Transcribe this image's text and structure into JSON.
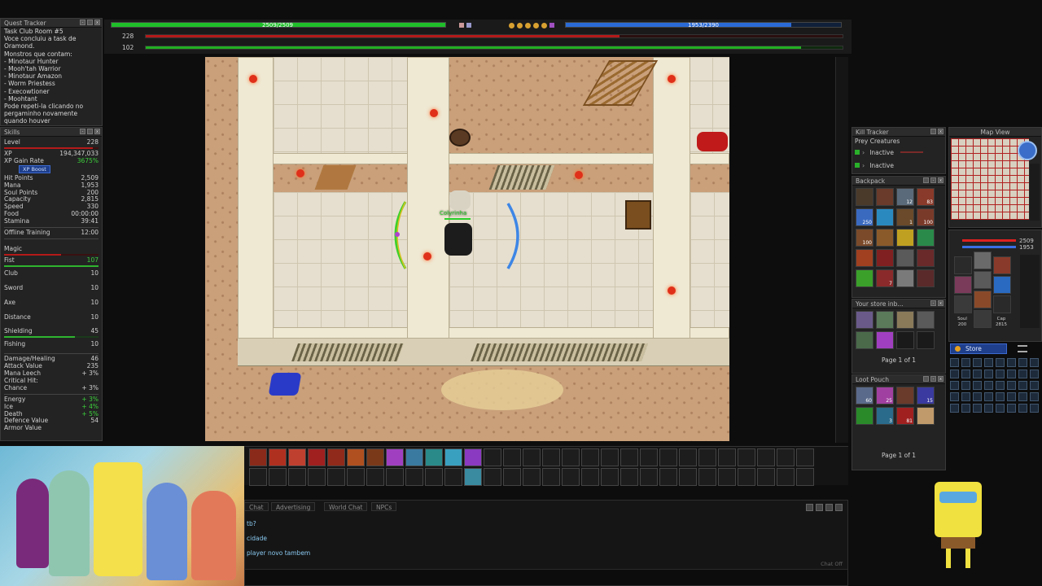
{
  "quest_tracker": {
    "title": "Quest Tracker",
    "lines": [
      "Task Club Room #5",
      "Voce concluiu a task de",
      "Oramond.",
      "Monstros que contam:",
      "- Minotaur Hunter",
      "- Mooh'tah Warrior",
      "- Minotaur Amazon",
      "- Worm Priestess",
      "- Execowtioner",
      "- Moohtant",
      "Pode repeti-la clicando no",
      "pergaminho novamente",
      "quando houver"
    ]
  },
  "skills": {
    "title": "Skills",
    "level": {
      "label": "Level",
      "value": "228"
    },
    "xp": {
      "label": "XP",
      "value": "194,347,033"
    },
    "xp_gain": {
      "label": "XP Gain Rate",
      "value": "3675%"
    },
    "xp_boost": "XP Boost",
    "stats": [
      {
        "label": "Hit Points",
        "value": "2,509"
      },
      {
        "label": "Mana",
        "value": "1,953"
      },
      {
        "label": "Soul Points",
        "value": "200"
      },
      {
        "label": "Capacity",
        "value": "2,815"
      },
      {
        "label": "Speed",
        "value": "330"
      },
      {
        "label": "Food",
        "value": "00:00:00"
      },
      {
        "label": "Stamina",
        "value": "39:41"
      }
    ],
    "offline_training": {
      "label": "Offline Training",
      "value": "12:00"
    },
    "magic": {
      "label": "Magic",
      "value": ""
    },
    "fist": {
      "label": "Fist",
      "value": "107"
    },
    "club": {
      "label": "Club",
      "value": "10"
    },
    "sword": {
      "label": "Sword",
      "value": "10"
    },
    "axe": {
      "label": "Axe",
      "value": "10"
    },
    "distance": {
      "label": "Distance",
      "value": "10"
    },
    "shielding": {
      "label": "Shielding",
      "value": "45"
    },
    "fishing": {
      "label": "Fishing",
      "value": "10"
    },
    "combat": [
      {
        "label": "Damage/Healing",
        "value": "46"
      },
      {
        "label": "Attack Value",
        "value": "235"
      },
      {
        "label": "Mana Leech",
        "value": "+ 3%"
      },
      {
        "label": "Critical Hit:",
        "value": ""
      },
      {
        "label": "Chance",
        "value": "+ 3%"
      }
    ],
    "resist": [
      {
        "label": "Energy",
        "value": "+ 3%"
      },
      {
        "label": "Ice",
        "value": "+ 4%"
      },
      {
        "label": "Death",
        "value": "+ 5%"
      },
      {
        "label": "Defence Value",
        "value": "54"
      },
      {
        "label": "Armor Value",
        "value": ""
      }
    ]
  },
  "top_bars": {
    "health_text": "2509/2509",
    "mana_text": "1953/2390",
    "level_label": "228",
    "magic_label": "102",
    "health_fill": 1.0,
    "mana_fill": 0.82,
    "level_fill": 0.68,
    "magic_fill": 0.94
  },
  "character": {
    "name": "Colyrinha"
  },
  "kill_tracker": {
    "title": "Kill Tracker",
    "subtitle": "Prey Creatures",
    "slots": [
      "Inactive",
      "Inactive"
    ]
  },
  "backpack": {
    "title": "Backpack",
    "counts": [
      "",
      "",
      "12",
      "83",
      "250",
      "",
      "1",
      "100",
      "100",
      "",
      "",
      "",
      "",
      "",
      "",
      "",
      "",
      "7",
      "",
      ""
    ]
  },
  "store_inbox": {
    "title": "Your store inb...",
    "page": "Page 1 of 1"
  },
  "loot_pouch": {
    "title": "Loot Pouch",
    "counts": [
      "60",
      "25",
      "",
      "15",
      "",
      "3",
      "81",
      ""
    ],
    "page": "Page 1 of 1"
  },
  "map_view": {
    "title": "Map View"
  },
  "minipanel": {
    "hp": "2509",
    "mana": "1953",
    "soul_label": "Soul",
    "soul": "200",
    "cap_label": "Cap",
    "cap": "2815"
  },
  "store_button": "Store",
  "chat": {
    "tabs": [
      "Chat",
      "Advertising",
      "World Chat",
      "NPCs"
    ],
    "lines": [
      "tb?",
      "cidade",
      "player novo tambem"
    ],
    "chat_off": "Chat Off"
  },
  "colors": {
    "health": "#1fbf2a",
    "mana": "#2a6ad6",
    "accent_red": "#b51a1a"
  }
}
